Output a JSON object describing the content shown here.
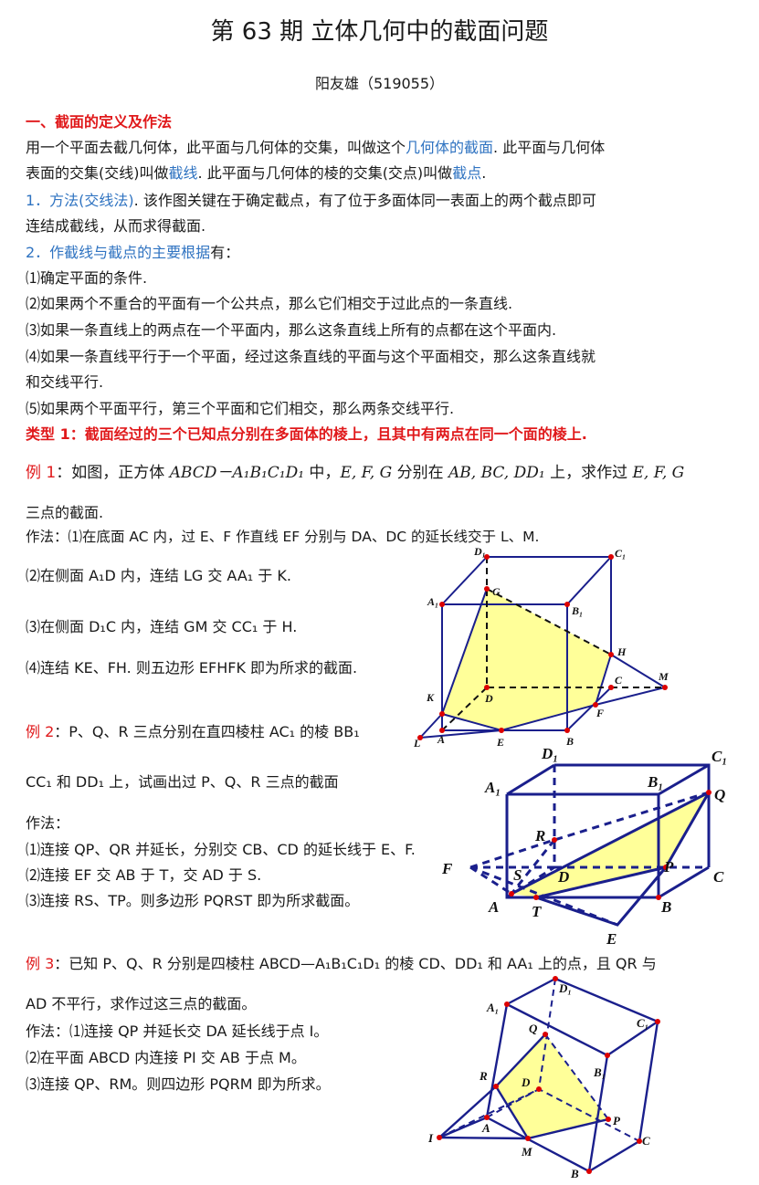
{
  "title": "第 63 期    立体几何中的截面问题",
  "author": "阳友雄（519055）",
  "s1": {
    "heading": "一、截面的定义及作法",
    "p1a": "用一个平面去截几何体，此平面与几何体的交集，叫做这个",
    "p1b": "几何体的截面",
    "p1c": ". 此平面与几何体",
    "p2a": "表面的交集(交线)叫做",
    "p2b": "截线",
    "p2c": ". 此平面与几何体的棱的交集(交点)叫做",
    "p2d": "截点",
    "p2e": ".",
    "m1a": "1．方法(交线法)",
    "m1b": ". 该作图关键在于确定截点，有了位于多面体同一表面上的两个截点即可",
    "m1c": "连结成截线，从而求得截面.",
    "m2a": "2．作截线与截点的主要根据",
    "m2b": "有：",
    "r1": "⑴确定平面的条件.",
    "r2": "⑵如果两个不重合的平面有一个公共点，那么它们相交于过此点的一条直线.",
    "r3": "⑶如果一条直线上的两点在一个平面内，那么这条直线上所有的点都在这个平面内.",
    "r4a": "⑷如果一条直线平行于一个平面，经过这条直线的平面与这个平面相交，那么这条直线就",
    "r4b": "和交线平行.",
    "r5": "⑸如果两个平面平行，第三个平面和它们相交，那么两条交线平行.",
    "type1": "类型 1：截面经过的三个已知点分别在多面体的棱上，且其中有两点在同一个面的棱上."
  },
  "ex1": {
    "label": "例 1",
    "a": "：如图，正方体 ",
    "cube": "ABCD－A₁B₁C₁D₁",
    "b": " 中，",
    "pts": "E, F, G",
    "c": " 分别在 ",
    "edges": "AB, BC, DD₁",
    "d": " 上，求作过 ",
    "pts2": "E, F, G",
    "e": "三点的截面.",
    "s1": "作法：⑴在底面 AC 内，过 E、F 作直线 EF 分别与 DA、DC 的延长线交于 L、M.",
    "s2": "⑵在侧面 A₁D 内，连结 LG 交 AA₁ 于 K.",
    "s3": "⑶在侧面 D₁C 内，连结 GM 交 CC₁ 于 H.",
    "s4": "⑷连结 KE、FH. 则五边形 EFHFK 即为所求的截面."
  },
  "ex2": {
    "label": "例 2",
    "a": "：P、Q、R 三点分别在直四棱柱 AC₁ 的棱 BB₁",
    "b": "CC₁ 和 DD₁ 上，试画出过 P、Q、R 三点的截面",
    "h": "作法：",
    "s1": "⑴连接 QP、QR 并延长，分别交 CB、CD 的延长线于 E、F.",
    "s2": "⑵连接 EF 交 AB 于 T，交 AD 于 S.",
    "s3": "⑶连接 RS、TP。则多边形 PQRST 即为所求截面。"
  },
  "ex3": {
    "label": "例 3",
    "a": "：已知 P、Q、R 分别是四棱柱 ABCD—A₁B₁C₁D₁ 的棱 CD、DD₁ 和 AA₁ 上的点，且 QR 与",
    "b": "AD 不平行，求作过这三点的截面。",
    "s1": "作法：⑴连接 QP 并延长交 DA 延长线于点 I。",
    "s2": "⑵在平面 ABCD 内连接 PI 交 AB 于点 M。",
    "s3": "⑶连接 QP、RM。则四边形 PQRM 即为所求。"
  },
  "fig1": {
    "D1": "D₁",
    "C1": "C₁",
    "A1": "A₁",
    "B1": "B₁",
    "G": "G",
    "H": "H",
    "C": "C",
    "M": "M",
    "D": "D",
    "K": "K",
    "F": "F",
    "L": "L",
    "A": "A",
    "E": "E",
    "B": "B"
  },
  "fig2": {
    "D1": "D₁",
    "C1": "C₁",
    "A1": "A₁",
    "B1": "B₁",
    "Q": "Q",
    "R": "R",
    "F": "F",
    "S": "S",
    "D": "D",
    "P": "P",
    "C": "C",
    "A": "A",
    "T": "T",
    "B": "B",
    "E": "E"
  },
  "fig3": {
    "D1": "D₁",
    "A1": "A₁",
    "C1": "C₁",
    "Q": "Q",
    "B1": "B₁",
    "R": "R",
    "D": "D",
    "P": "P",
    "I": "I",
    "A": "A",
    "C": "C",
    "M": "M",
    "B": "B"
  },
  "colors": {
    "red": "#e0191b",
    "blue": "#2f73c1",
    "edge": "#1a1f8c",
    "fill": "#ffff99"
  }
}
